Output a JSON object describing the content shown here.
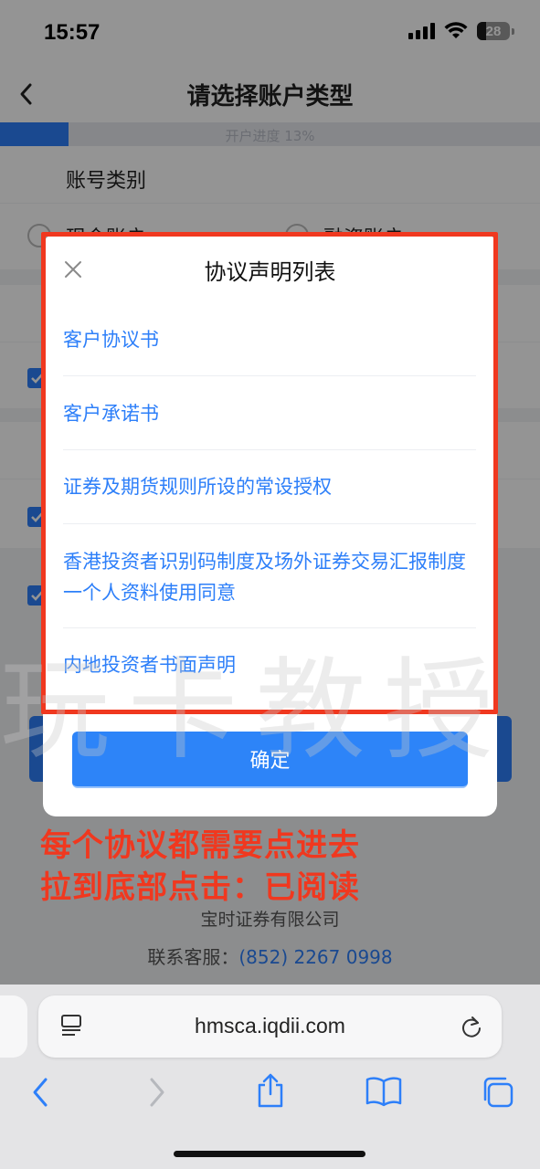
{
  "status_bar": {
    "time": "15:57",
    "battery": "28"
  },
  "header": {
    "title": "请选择账户类型"
  },
  "progress": {
    "label": "开户进度 13%",
    "percent": 13
  },
  "account": {
    "section_label": "账号类别",
    "options": [
      "现金账户",
      "融资账户"
    ]
  },
  "modal": {
    "title": "协议声明列表",
    "items": [
      "客户协议书",
      "客户承诺书",
      "证券及期货规则所设的常设授权",
      "香港投资者识别码制度及场外证券交易汇报制度一个人资料使用同意",
      "内地投资者书面声明"
    ],
    "confirm_label": "确定"
  },
  "annotation": {
    "line1": "每个协议都需要点进去",
    "line2": "拉到底部点击：已阅读"
  },
  "watermark": "玩卡教授",
  "footer": {
    "company": "宝时证券有限公司",
    "hotline_label": "联系客服：",
    "hotline_number": "(852) 2267 0998"
  },
  "browser": {
    "url": "hmsca.iqdii.com"
  },
  "colors": {
    "accent": "#2d7ff9",
    "annotation": "#f0381f"
  },
  "icons": [
    "signal-icon",
    "wifi-icon",
    "battery-icon",
    "back-chevron-icon",
    "close-icon",
    "tabs-icon",
    "reload-icon",
    "back-icon",
    "forward-icon",
    "share-icon",
    "bookmarks-icon",
    "tab-switcher-icon"
  ]
}
